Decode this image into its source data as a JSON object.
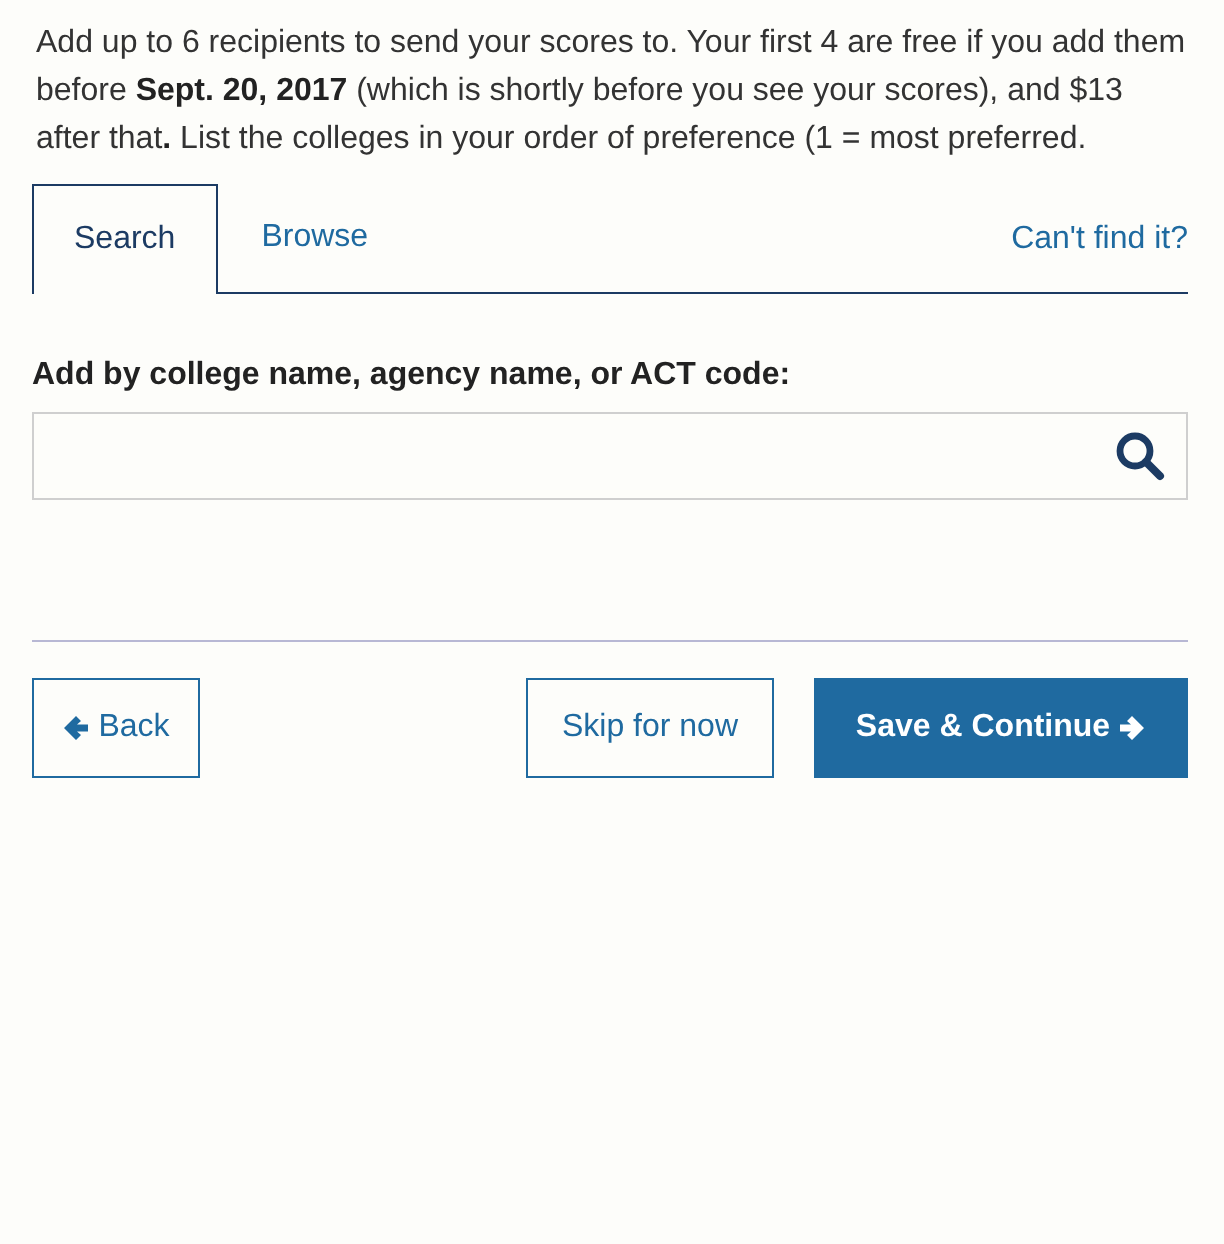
{
  "intro": "Add up to 6 recipients to send your scores to. Your first 4 are free if you add them before **Sept. 20, 2017** (which is shortly before you see your scores), and $13 after that**.** List the colleges in your order of preference (1 = most preferred.",
  "tabs": [
    {
      "label": "Search",
      "selected": true
    },
    {
      "label": "Browse",
      "selected": false
    }
  ],
  "help_link": "Can't find it?",
  "search": {
    "label": "Add by college name, agency name, or ACT code:"
  },
  "buttons": [
    {
      "label": "Back",
      "kind": "back"
    },
    {
      "label": "Skip for now",
      "kind": "skip"
    },
    {
      "label": "Save & Continue",
      "kind": "continue"
    }
  ]
}
